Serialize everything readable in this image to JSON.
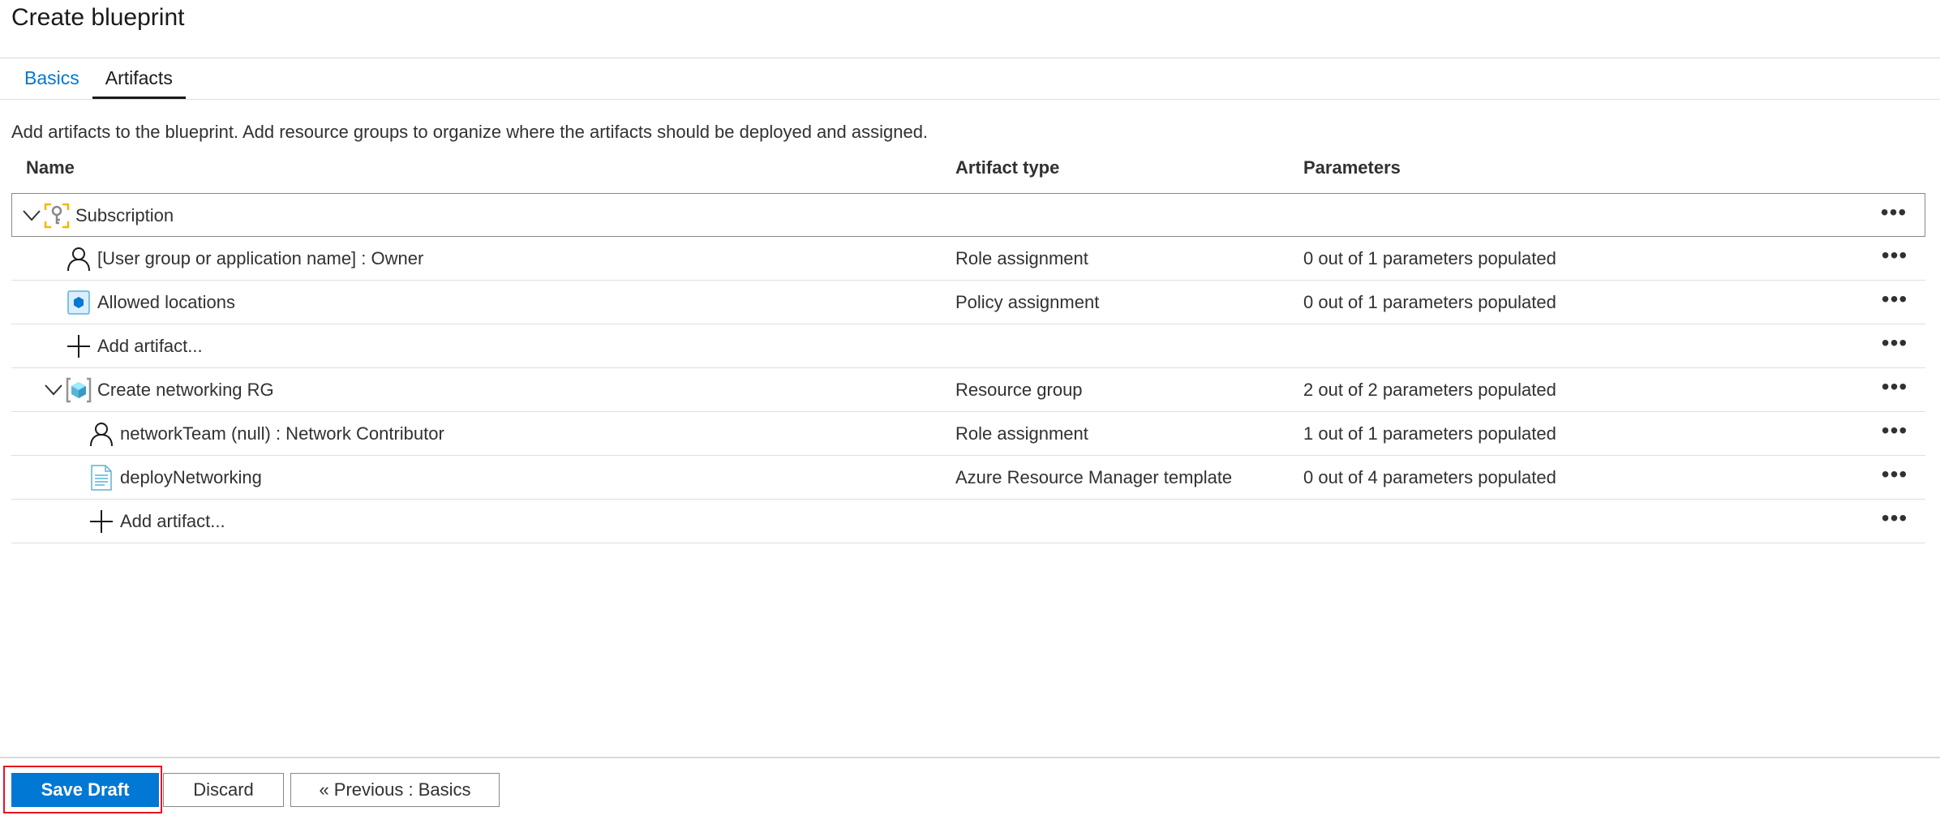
{
  "page": {
    "title": "Create blueprint"
  },
  "tabs": [
    {
      "label": "Basics",
      "active": false
    },
    {
      "label": "Artifacts",
      "active": true
    }
  ],
  "description": "Add artifacts to the blueprint. Add resource groups to organize where the artifacts should be deployed and assigned.",
  "columns": {
    "name": "Name",
    "type": "Artifact type",
    "params": "Parameters"
  },
  "rows": [
    {
      "name": "Subscription",
      "type": "",
      "params": "",
      "icon": "subscription-key-icon",
      "expanded": true
    },
    {
      "name": "[User group or application name] : Owner",
      "type": "Role assignment",
      "params": "0 out of 1 parameters populated",
      "icon": "user-icon"
    },
    {
      "name": "Allowed locations",
      "type": "Policy assignment",
      "params": "0 out of 1 parameters populated",
      "icon": "policy-icon"
    },
    {
      "name": "Add artifact...",
      "type": "",
      "params": "",
      "icon": "plus-icon"
    },
    {
      "name": "Create networking RG",
      "type": "Resource group",
      "params": "2 out of 2 parameters populated",
      "icon": "resource-group-icon",
      "expanded": true
    },
    {
      "name": "networkTeam (null) : Network Contributor",
      "type": "Role assignment",
      "params": "1 out of 1 parameters populated",
      "icon": "user-icon"
    },
    {
      "name": "deployNetworking",
      "type": "Azure Resource Manager template",
      "params": "0 out of 4 parameters populated",
      "icon": "template-icon"
    },
    {
      "name": "Add artifact...",
      "type": "",
      "params": "",
      "icon": "plus-icon"
    }
  ],
  "row_menu_glyph": "•••",
  "footer": {
    "save": "Save Draft",
    "discard": "Discard",
    "previous": "« Previous : Basics"
  },
  "colors": {
    "accent": "#0078d4",
    "highlight": "#e81123"
  }
}
